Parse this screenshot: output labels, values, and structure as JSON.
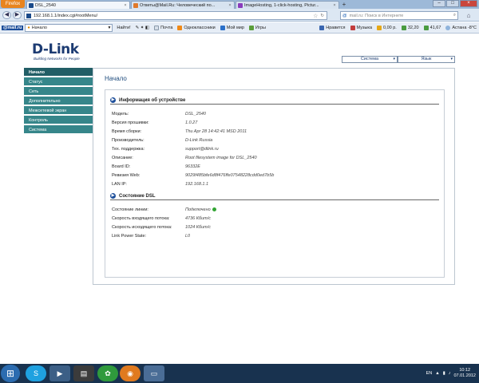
{
  "browser": {
    "menu_label": "Firefox",
    "tabs": [
      {
        "title": "DSL_2540",
        "color": "#1a4a8a",
        "active": true
      },
      {
        "title": "Ответы@Mail.Ru: Человеческий по...",
        "color": "#e0792a",
        "active": false
      },
      {
        "title": "ImageHosting, 1-click-hosting, Pictur...",
        "color": "#8a3cbc",
        "active": false
      }
    ],
    "new_tab": "+",
    "url": "192.168.1.1/index.cgi#rootMenu/",
    "search_placeholder": "mail.ru: Поиск в Интернете",
    "search_engine": "@"
  },
  "toolbar": {
    "brand": "@mail.ru",
    "combo_value": "Начало",
    "find": "Найти!",
    "items": [
      "Почта",
      "Одноклассники",
      "Мой мир",
      "Игры"
    ],
    "right_items": [
      "Нравится",
      "Музыка",
      "0,00 р.",
      "32,20",
      "41,67",
      "Астана -8°C"
    ]
  },
  "router": {
    "logo_text": "D-Link",
    "logo_tagline": "Building Networks for People",
    "system_menu": "Система",
    "language_menu": "Язык",
    "sidebar": [
      "Начало",
      "Статус",
      "Сеть",
      "Дополнительно",
      "Межсетевой экран",
      "Контроль",
      "Система"
    ],
    "active_item": "Начало",
    "page_title": "Начало",
    "device_info": {
      "heading": "Информация об устройстве",
      "rows": [
        {
          "label": "Модель:",
          "value": "DSL_2540"
        },
        {
          "label": "Версия прошивки:",
          "value": "1.0.27"
        },
        {
          "label": "Время сборки:",
          "value": "Thu Apr 28 14:42:41 MSD 2011"
        },
        {
          "label": "Производитель:",
          "value": "D-Link Russia"
        },
        {
          "label": "Тех. поддержка:",
          "value": "support@dlink.ru"
        },
        {
          "label": "Описание:",
          "value": "Root filesystem image for DSL_2540"
        },
        {
          "label": "Board ID:",
          "value": "96332E"
        },
        {
          "label": "Ревизия Web:",
          "value": "9029f485bfe6d8f476ffe07548228cdd0ed7b5b"
        },
        {
          "label": "LAN IP:",
          "value": "192.168.1.1"
        }
      ]
    },
    "dsl_status": {
      "heading": "Состояние DSL",
      "rows": [
        {
          "label": "Состояние линии:",
          "value": "Подключено"
        },
        {
          "label": "Скорость входящего потока:",
          "value": "4736 Кбит/с"
        },
        {
          "label": "Скорость исходящего потока:",
          "value": "1024 Кбит/с"
        },
        {
          "label": "Link Power State:",
          "value": "L0"
        }
      ]
    }
  },
  "taskbar": {
    "lang": "EN",
    "time": "10:12",
    "date": "07.01.2012"
  }
}
